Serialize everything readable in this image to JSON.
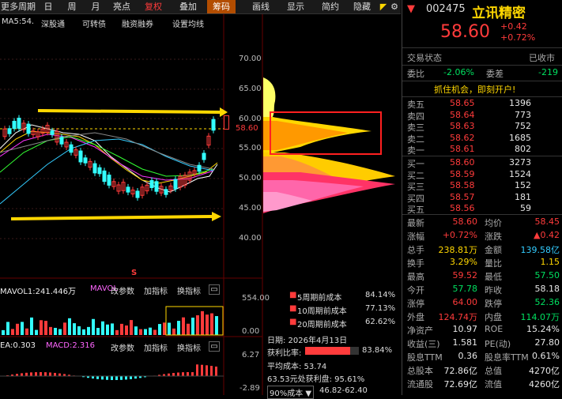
{
  "toolbar": {
    "items": [
      "更多周期",
      "日",
      "周",
      "月",
      "亮点",
      "复权",
      "叠加",
      "筹码",
      "画线",
      "显示",
      "简约",
      "隐藏"
    ],
    "active": "筹码"
  },
  "indicators": {
    "ma_line": "MA5:54.",
    "shen_gu_tong": "深股通",
    "convertible": "可转债",
    "margin": "融资融券",
    "settings": "设置均线"
  },
  "price_axis": [
    "70.00",
    "65.00",
    "60.00",
    "55.00",
    "50.00",
    "45.00",
    "40.00"
  ],
  "current_price_tag": "58.60",
  "marker_s": "S",
  "volume_panel": {
    "label": "MAVOL1:241.446万",
    "label2": "MAVOL",
    "edit": "改参数",
    "add": "加指标",
    "switch": "换指标",
    "axis_top": "554.00",
    "axis_bottom": "0.00"
  },
  "macd_panel": {
    "label": "EA:0.303",
    "label2": "MACD:2.316",
    "edit": "改参数",
    "add": "加指标",
    "switch": "换指标",
    "axis_top": "6.27",
    "axis_bottom": "-2.89"
  },
  "chip": {
    "legend": [
      {
        "label": "5周期前成本",
        "value": "84.14%"
      },
      {
        "label": "10周期前成本",
        "value": "77.13%"
      },
      {
        "label": "20周期前成本",
        "value": "62.62%"
      }
    ],
    "date": "日期: 2026年4月13日",
    "profit_ratio_label": "获利比率:",
    "profit_ratio_value": "83.84%",
    "avg_cost": "平均成本: 53.74",
    "cost_at_price": "63.53元处获利盘: 95.61%",
    "cost_range_label": "90%成本",
    "cost_range_value": "46.82-62.40"
  },
  "quote": {
    "code": "002475",
    "name": "立讯精密",
    "price": "58.60",
    "change": "+0.42",
    "change_pct": "+0.72%",
    "status_label": "交易状态",
    "status_value": "已收市",
    "webi_label": "委比",
    "webi_value": "-2.06%",
    "weicha_label": "委差",
    "weicha_value": "-219",
    "banner": "抓住机会，即刻开户!",
    "asks": [
      {
        "label": "卖五",
        "price": "58.65",
        "vol": "1396"
      },
      {
        "label": "卖四",
        "price": "58.64",
        "vol": "773"
      },
      {
        "label": "卖三",
        "price": "58.63",
        "vol": "752"
      },
      {
        "label": "卖二",
        "price": "58.62",
        "vol": "1685"
      },
      {
        "label": "卖一",
        "price": "58.61",
        "vol": "802"
      }
    ],
    "bids": [
      {
        "label": "买一",
        "price": "58.60",
        "vol": "3273"
      },
      {
        "label": "买二",
        "price": "58.59",
        "vol": "1524"
      },
      {
        "label": "买三",
        "price": "58.58",
        "vol": "152"
      },
      {
        "label": "买四",
        "price": "58.57",
        "vol": "181"
      },
      {
        "label": "买五",
        "price": "58.56",
        "vol": "59"
      }
    ],
    "stats": [
      {
        "l1": "最新",
        "v1": "58.60",
        "c1": "red",
        "l2": "均价",
        "v2": "58.45",
        "c2": "red"
      },
      {
        "l1": "涨幅",
        "v1": "+0.72%",
        "c1": "red",
        "l2": "涨跌",
        "v2": "▲0.42",
        "c2": "red"
      },
      {
        "l1": "总手",
        "v1": "238.81万",
        "c1": "yellow",
        "l2": "金额",
        "v2": "139.58亿",
        "c2": "cyan"
      },
      {
        "l1": "换手",
        "v1": "3.29%",
        "c1": "yellow",
        "l2": "量比",
        "v2": "1.15",
        "c2": "yellow"
      },
      {
        "l1": "最高",
        "v1": "59.52",
        "c1": "red",
        "l2": "最低",
        "v2": "57.50",
        "c2": "green"
      },
      {
        "l1": "今开",
        "v1": "57.78",
        "c1": "green",
        "l2": "昨收",
        "v2": "58.18",
        "c2": "white"
      },
      {
        "l1": "涨停",
        "v1": "64.00",
        "c1": "red",
        "l2": "跌停",
        "v2": "52.36",
        "c2": "green"
      },
      {
        "l1": "外盘",
        "v1": "124.74万",
        "c1": "red",
        "l2": "内盘",
        "v2": "114.07万",
        "c2": "green"
      },
      {
        "l1": "净资产",
        "v1": "10.97",
        "c1": "white",
        "l2": "ROE",
        "v2": "15.24%",
        "c2": "white"
      },
      {
        "l1": "收益(三)",
        "v1": "1.581",
        "c1": "white",
        "l2": "PE(动)",
        "v2": "27.80",
        "c2": "white"
      },
      {
        "l1": "股息TTM",
        "v1": "0.36",
        "c1": "white",
        "l2": "股息率TTM",
        "v2": "0.61%",
        "c2": "white"
      },
      {
        "l1": "总股本",
        "v1": "72.86亿",
        "c1": "white",
        "l2": "总值",
        "v2": "4270亿",
        "c2": "white"
      },
      {
        "l1": "流通股",
        "v1": "72.69亿",
        "c1": "white",
        "l2": "流值",
        "v2": "4260亿",
        "c2": "white"
      }
    ]
  },
  "colors": {
    "up": "#ff3b3b",
    "down": "#00e060",
    "accent": "#ffd700",
    "active_tab": "#b34d00"
  }
}
